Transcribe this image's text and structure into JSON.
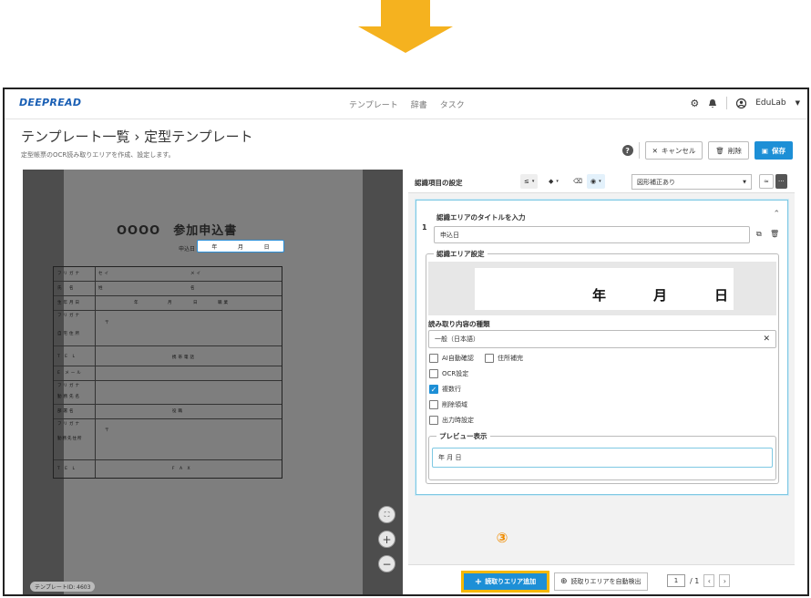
{
  "colors": {
    "brand": "#1a5fb4",
    "primary": "#1d8fd6",
    "annotation": "#f08c00",
    "highlight": "#f5b800"
  },
  "nav": {
    "logo": "DEEPREAD",
    "links": [
      "テンプレート",
      "辞書",
      "タスク"
    ],
    "user": "EduLab"
  },
  "page": {
    "title": "テンプレート一覧 ›  定型テンプレート",
    "subtitle": "定型帳票のOCR読み取りエリアを作成、設定します。"
  },
  "header_buttons": {
    "help": "?",
    "cancel": "キャンセル",
    "delete": "削除",
    "save": "保存"
  },
  "viewer": {
    "doc_title": "OOOO　参加申込書",
    "date_label": "申込日",
    "date_parts": [
      "年",
      "月",
      "日"
    ],
    "form_labels": [
      "フリガナ",
      "氏　名",
      "生年月日",
      "年",
      "月",
      "日",
      "職業",
      "フリガナ",
      "自宅住所",
      "T E L",
      "携帯電話",
      "E メール",
      "フリガナ",
      "勤務先名",
      "部署名",
      "役職",
      "フリガナ",
      "勤務先住所",
      "T E L",
      "F A X",
      "セイ",
      "メイ",
      "姓",
      "名",
      "〒",
      "〒"
    ],
    "template_id": "テンプレートID: 4603",
    "zoom_icons": [
      "fit-icon",
      "zoom-in-icon",
      "zoom-out-icon"
    ]
  },
  "panel": {
    "header_title": "認識項目の設定",
    "tools": [
      "≤",
      "▾",
      "◆",
      "▾",
      "⌫",
      "◉",
      "▾"
    ],
    "shape_select": "図形補正あり",
    "card": {
      "number": "1",
      "title": "認識エリアのタイトルを入力",
      "title_value": "申込日",
      "area_legend": "認識エリア設定",
      "area_preview": [
        "年",
        "月",
        "日"
      ],
      "read_type_label": "読み取り内容の種類",
      "read_type_value": "一般（日本語）",
      "options": [
        {
          "label": "AI自動確認",
          "checked": false
        },
        {
          "label": "住所補完",
          "checked": false
        },
        {
          "label": "OCR設定",
          "checked": false
        },
        {
          "label": "複数行",
          "checked": true
        },
        {
          "label": "削除領域",
          "checked": false
        },
        {
          "label": "出力時設定",
          "checked": false
        }
      ],
      "preview_legend": "プレビュー表示",
      "preview_value": "年 月 日"
    }
  },
  "annotation": {
    "step": "③"
  },
  "bottom": {
    "add_area": "読取りエリア追加",
    "auto_detect": "読取りエリアを自動検出",
    "page_current": "1",
    "page_total": "/ 1"
  }
}
